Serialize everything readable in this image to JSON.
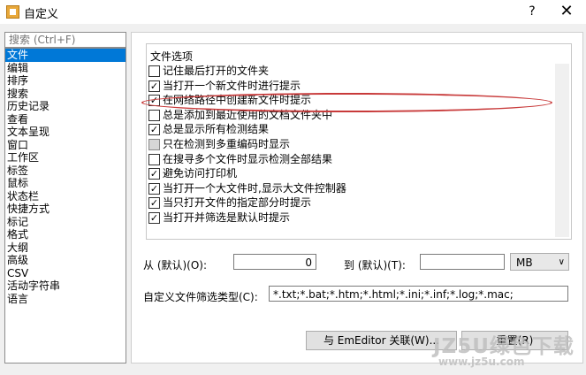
{
  "window": {
    "title": "自定义",
    "help": "?",
    "close": "✕"
  },
  "search": {
    "placeholder": "搜索 (Ctrl+F)"
  },
  "nav": {
    "items": [
      "文件",
      "编辑",
      "排序",
      "搜索",
      "历史记录",
      "查看",
      "文本呈现",
      "窗口",
      "工作区",
      "标签",
      "鼠标",
      "状态栏",
      "快捷方式",
      "标记",
      "格式",
      "大纲",
      "高级",
      "CSV",
      "活动字符串",
      "语言"
    ],
    "selected_index": 0
  },
  "file_options": {
    "group_title": "文件选项",
    "options": [
      {
        "label": "记住最后打开的文件夹",
        "checked": false,
        "enabled": true
      },
      {
        "label": "当打开一个新文件时进行提示",
        "checked": true,
        "enabled": true
      },
      {
        "label": "在网络路径中创建新文件时提示",
        "checked": true,
        "enabled": true
      },
      {
        "label": "总是添加到最近使用的文档文件夹中",
        "checked": false,
        "enabled": true
      },
      {
        "label": "总是显示所有检测结果",
        "checked": true,
        "enabled": true
      },
      {
        "label": "只在检测到多重编码时显示",
        "checked": false,
        "enabled": false
      },
      {
        "label": "在搜寻多个文件时显示检测全部结果",
        "checked": false,
        "enabled": true
      },
      {
        "label": "避免访问打印机",
        "checked": true,
        "enabled": true
      },
      {
        "label": "当打开一个大文件时,显示大文件控制器",
        "checked": true,
        "enabled": true
      },
      {
        "label": "当只打开文件的指定部分时提示",
        "checked": true,
        "enabled": true
      },
      {
        "label": "当打开并筛选是默认时提示",
        "checked": true,
        "enabled": true
      }
    ]
  },
  "size_range": {
    "from_label": "从 (默认)(O):",
    "from_value": "0",
    "to_label": "到 (默认)(T):",
    "to_value": "",
    "unit": "MB"
  },
  "filter": {
    "label": "自定义文件筛选类型(C):",
    "value": "*.txt;*.bat;*.htm;*.html;*.ini;*.inf;*.log;*.mac;"
  },
  "buttons": {
    "associate": "与 EmEditor 关联(W)...",
    "reset": "重置(R)"
  },
  "watermark": {
    "line1": "JZ5U绿色下载",
    "line2": "www.jz5u.com"
  }
}
